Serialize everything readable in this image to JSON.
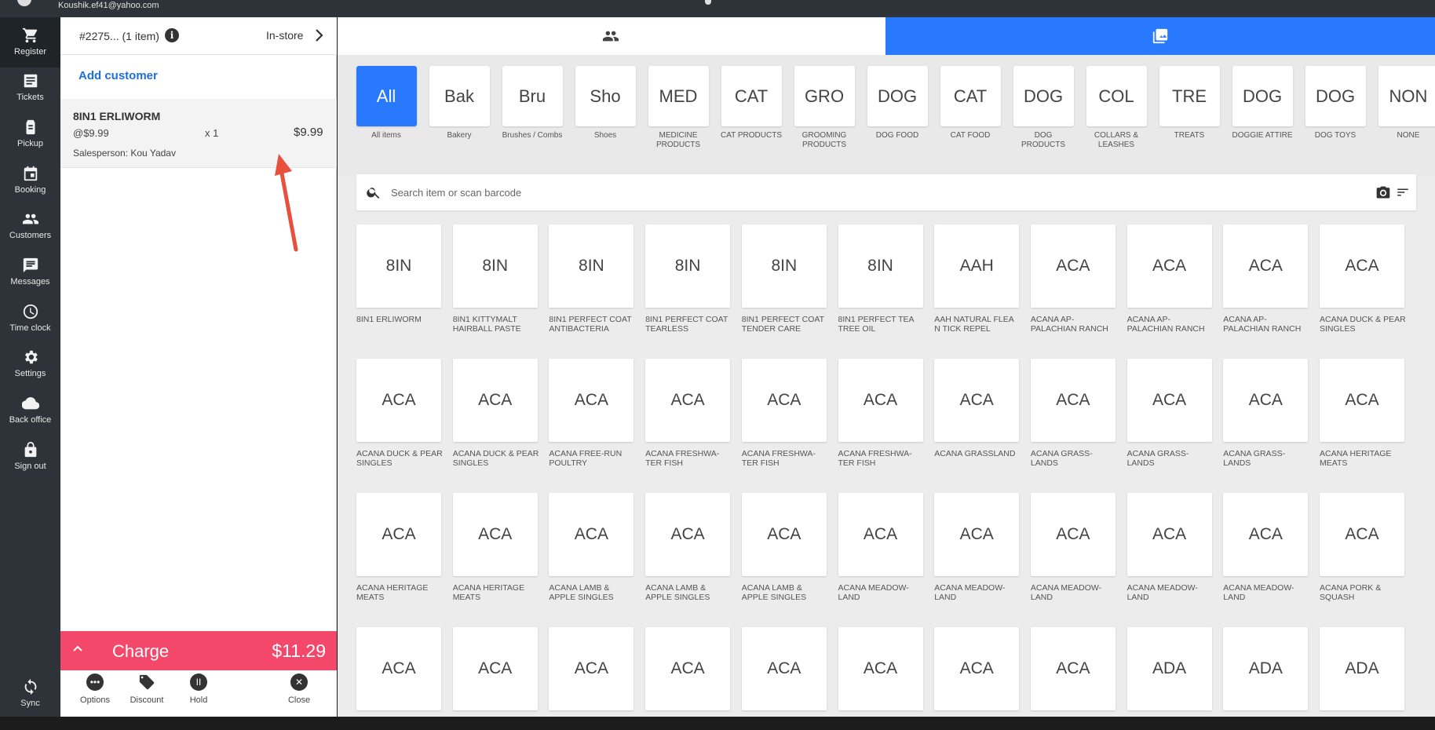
{
  "account": {
    "email": "Koushik.ef41@yahoo.com"
  },
  "nav": {
    "items": [
      {
        "key": "register",
        "label": "Register",
        "icon": "cart-icon"
      },
      {
        "key": "tickets",
        "label": "Tickets",
        "icon": "tickets-icon"
      },
      {
        "key": "pickup",
        "label": "Pickup",
        "icon": "pickup-icon"
      },
      {
        "key": "booking",
        "label": "Booking",
        "icon": "calendar-icon"
      },
      {
        "key": "customers",
        "label": "Customers",
        "icon": "people-icon"
      },
      {
        "key": "messages",
        "label": "Messages",
        "icon": "message-icon"
      },
      {
        "key": "timeclock",
        "label": "Time clock",
        "icon": "clock-icon"
      },
      {
        "key": "settings",
        "label": "Settings",
        "icon": "gear-icon"
      },
      {
        "key": "backoffice",
        "label": "Back office",
        "icon": "cloud-icon"
      },
      {
        "key": "signout",
        "label": "Sign out",
        "icon": "lock-icon"
      }
    ],
    "sync_label": "Sync"
  },
  "cart": {
    "ticket": "#2275... (1 item)",
    "mode": "In-store",
    "add_customer": "Add customer",
    "line_item": {
      "name": "8IN1 ERLIWORM",
      "unit_price": "@$9.99",
      "qty": "x  1",
      "total": "$9.99",
      "salesperson": "Salesperson: Kou Yadav"
    },
    "charge_label": "Charge",
    "charge_amount": "$11.29",
    "actions": [
      {
        "label": "Options",
        "icon": "more-icon"
      },
      {
        "label": "Discount",
        "icon": "tag-icon"
      },
      {
        "label": "Hold",
        "icon": "pause-icon"
      },
      {
        "label": "Close",
        "icon": "close-icon"
      }
    ]
  },
  "categories": [
    {
      "abbr": "All",
      "name": "All items",
      "active": true
    },
    {
      "abbr": "Bak",
      "name": "Bakery"
    },
    {
      "abbr": "Bru",
      "name": "Brushes / Combs"
    },
    {
      "abbr": "Sho",
      "name": "Shoes"
    },
    {
      "abbr": "MED",
      "name": "MEDICINE PRODUCTS"
    },
    {
      "abbr": "CAT",
      "name": "CAT PRODUCTS"
    },
    {
      "abbr": "GRO",
      "name": "GROOMING PRODUCTS"
    },
    {
      "abbr": "DOG",
      "name": "DOG FOOD"
    },
    {
      "abbr": "CAT",
      "name": "CAT FOOD"
    },
    {
      "abbr": "DOG",
      "name": "DOG PRODUCTS"
    },
    {
      "abbr": "COL",
      "name": "COLLARS & LEASHES"
    },
    {
      "abbr": "TRE",
      "name": "TREATS"
    },
    {
      "abbr": "DOG",
      "name": "DOGGIE ATTIRE"
    },
    {
      "abbr": "DOG",
      "name": "DOG TOYS"
    },
    {
      "abbr": "NON",
      "name": "NONE"
    }
  ],
  "search": {
    "placeholder": "Search item or scan barcode"
  },
  "items": [
    {
      "abbr": "8IN",
      "name": "8IN1 ERLIWORM"
    },
    {
      "abbr": "8IN",
      "name": "8IN1 KITTYMALT HAIRBALL PASTE"
    },
    {
      "abbr": "8IN",
      "name": "8IN1 PERFECT COAT ANTIBACTERIA"
    },
    {
      "abbr": "8IN",
      "name": "8IN1 PERFECT COAT TEARLESS"
    },
    {
      "abbr": "8IN",
      "name": "8IN1 PERFECT COAT TENDER CARE"
    },
    {
      "abbr": "8IN",
      "name": "8IN1 PERFECT TEA TREE OIL"
    },
    {
      "abbr": "AAH",
      "name": "AAH NATURAL FLEA N TICK REPEL"
    },
    {
      "abbr": "ACA",
      "name": "ACANA AP-PALACHIAN RANCH"
    },
    {
      "abbr": "ACA",
      "name": "ACANA AP-PALACHIAN RANCH"
    },
    {
      "abbr": "ACA",
      "name": "ACANA AP-PALACHIAN RANCH"
    },
    {
      "abbr": "ACA",
      "name": "ACANA DUCK & PEAR SINGLES"
    },
    {
      "abbr": "ACA",
      "name": "ACANA DUCK & PEAR SINGLES"
    },
    {
      "abbr": "ACA",
      "name": "ACANA DUCK & PEAR SINGLES"
    },
    {
      "abbr": "ACA",
      "name": "ACANA FREE-RUN POULTRY"
    },
    {
      "abbr": "ACA",
      "name": "ACANA FRESHWA-TER FISH"
    },
    {
      "abbr": "ACA",
      "name": "ACANA FRESHWA-TER FISH"
    },
    {
      "abbr": "ACA",
      "name": "ACANA FRESHWA-TER FISH"
    },
    {
      "abbr": "ACA",
      "name": "ACANA GRASSLAND"
    },
    {
      "abbr": "ACA",
      "name": "ACANA GRASS-LANDS"
    },
    {
      "abbr": "ACA",
      "name": "ACANA GRASS-LANDS"
    },
    {
      "abbr": "ACA",
      "name": "ACANA GRASS-LANDS"
    },
    {
      "abbr": "ACA",
      "name": "ACANA HERITAGE MEATS"
    },
    {
      "abbr": "ACA",
      "name": "ACANA HERITAGE MEATS"
    },
    {
      "abbr": "ACA",
      "name": "ACANA HERITAGE MEATS"
    },
    {
      "abbr": "ACA",
      "name": "ACANA LAMB & APPLE SINGLES"
    },
    {
      "abbr": "ACA",
      "name": "ACANA LAMB & APPLE SINGLES"
    },
    {
      "abbr": "ACA",
      "name": "ACANA LAMB & APPLE SINGLES"
    },
    {
      "abbr": "ACA",
      "name": "ACANA MEADOW-LAND"
    },
    {
      "abbr": "ACA",
      "name": "ACANA MEADOW-LAND"
    },
    {
      "abbr": "ACA",
      "name": "ACANA MEADOW-LAND"
    },
    {
      "abbr": "ACA",
      "name": "ACANA MEADOW-LAND"
    },
    {
      "abbr": "ACA",
      "name": "ACANA MEADOW-LAND"
    },
    {
      "abbr": "ACA",
      "name": "ACANA PORK & SQUASH"
    },
    {
      "abbr": "ACA",
      "name": ""
    },
    {
      "abbr": "ACA",
      "name": ""
    },
    {
      "abbr": "ACA",
      "name": ""
    },
    {
      "abbr": "ACA",
      "name": ""
    },
    {
      "abbr": "ACA",
      "name": ""
    },
    {
      "abbr": "ACA",
      "name": ""
    },
    {
      "abbr": "ACA",
      "name": ""
    },
    {
      "abbr": "ACA",
      "name": ""
    },
    {
      "abbr": "ADA",
      "name": ""
    },
    {
      "abbr": "ADA",
      "name": ""
    },
    {
      "abbr": "ADA",
      "name": ""
    }
  ],
  "colors": {
    "accent": "#2979ff",
    "charge": "#f4486a",
    "link": "#1e6fd9",
    "rail": "#2d3338"
  }
}
